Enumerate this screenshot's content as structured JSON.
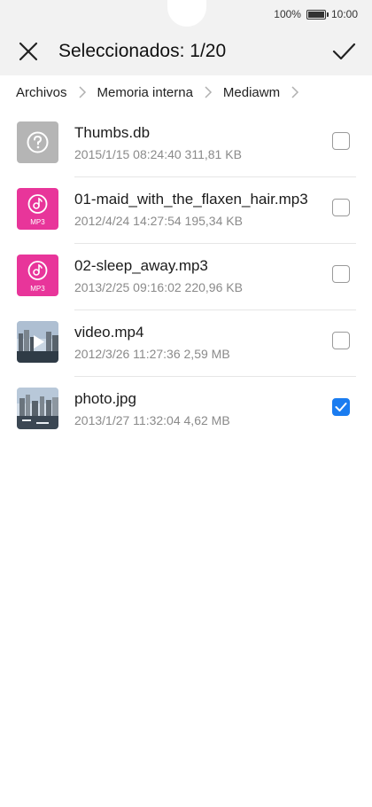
{
  "status_bar": {
    "battery_text": "100%",
    "time": "10:00"
  },
  "toolbar": {
    "title": "Seleccionados: 1/20"
  },
  "breadcrumb": [
    "Archivos",
    "Memoria interna",
    "Mediawm"
  ],
  "files": [
    {
      "name": "Thumbs.db",
      "meta": "2015/1/15 08:24:40 311,81 KB",
      "type": "unknown",
      "checked": false
    },
    {
      "name": "01-maid_with_the_flaxen_hair.mp3",
      "meta": "2012/4/24 14:27:54 195,34 KB",
      "type": "mp3",
      "type_label": "MP3",
      "checked": false
    },
    {
      "name": "02-sleep_away.mp3",
      "meta": "2013/2/25 09:16:02 220,96 KB",
      "type": "mp3",
      "type_label": "MP3",
      "checked": false
    },
    {
      "name": "video.mp4",
      "meta": "2012/3/26 11:27:36 2,59 MB",
      "type": "video",
      "checked": false
    },
    {
      "name": "photo.jpg",
      "meta": "2013/1/27 11:32:04 4,62 MB",
      "type": "image",
      "checked": true
    }
  ],
  "colors": {
    "accent": "#1a7cf0",
    "mp3_icon": "#e8359a",
    "unknown_icon": "#b5b5b5"
  }
}
